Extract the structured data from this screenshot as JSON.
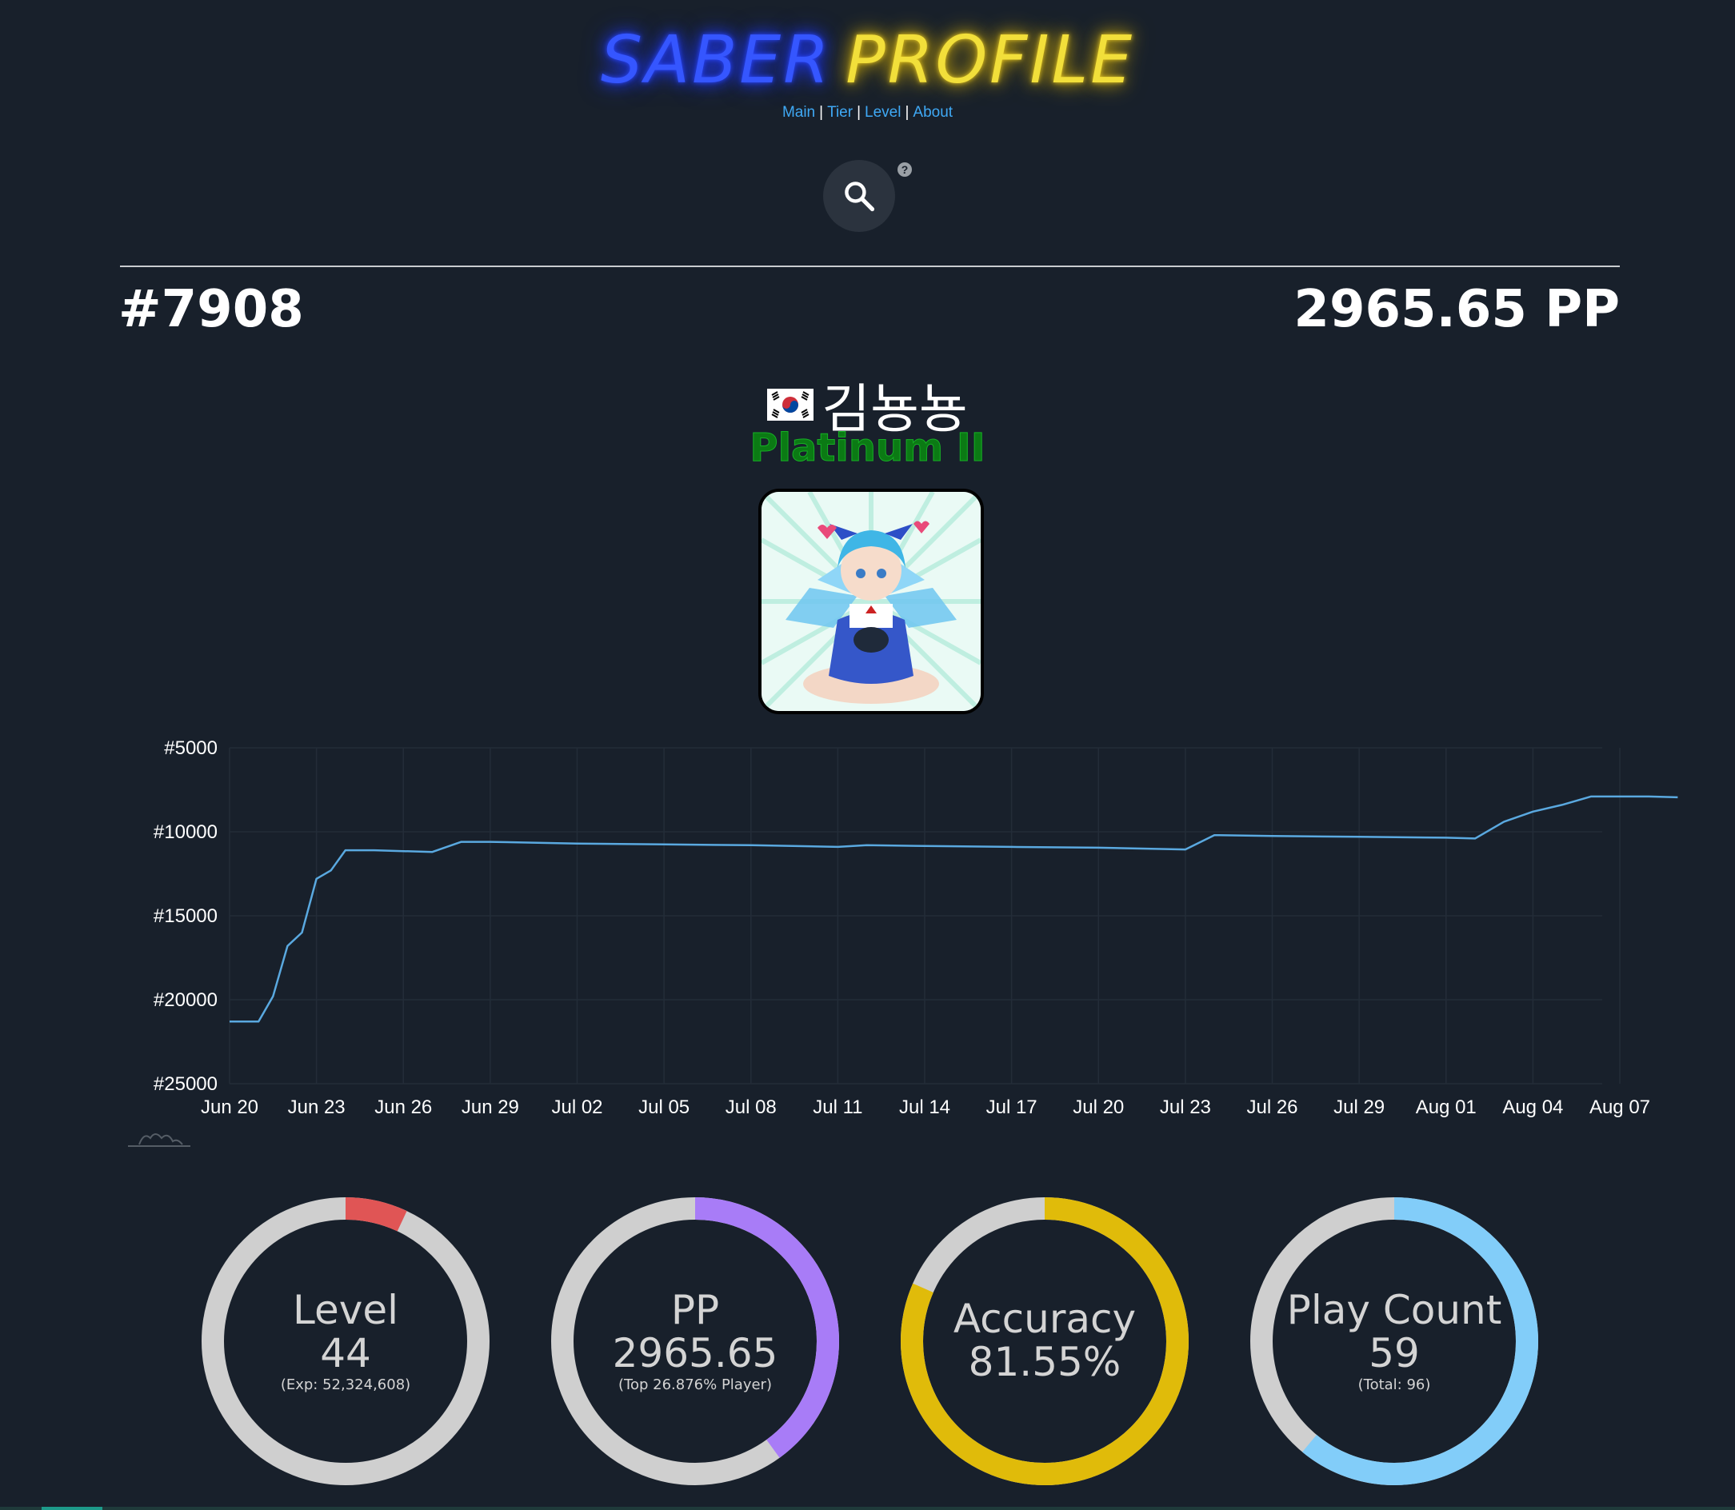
{
  "site": {
    "title_part1": "SABER",
    "title_part2": "PROFILE",
    "nav": [
      "Main",
      "Tier",
      "Level",
      "About"
    ],
    "search_icon": "search-icon",
    "help_icon": "question-circle-icon",
    "help_glyph": "?"
  },
  "profile": {
    "rank": "#7908",
    "pp": "2965.65 PP",
    "country_flag": "south-korea-flag-icon",
    "name": "김뇽뇽",
    "tier": "Platinum II",
    "tier_color": "#0b7a14",
    "avatar": "anime-character-avatar"
  },
  "chart_data": {
    "type": "line",
    "y_reversed": true,
    "ylim": [
      5000,
      25000
    ],
    "y_ticks": [
      "#5000",
      "#10000",
      "#15000",
      "#20000",
      "#25000"
    ],
    "x_ticks": [
      "Jun 20",
      "Jun 23",
      "Jun 26",
      "Jun 29",
      "Jul 02",
      "Jul 05",
      "Jul 08",
      "Jul 11",
      "Jul 14",
      "Jul 17",
      "Jul 20",
      "Jul 23",
      "Jul 26",
      "Jul 29",
      "Aug 01",
      "Aug 04",
      "Aug 07"
    ],
    "series_color": "#5aa9e0",
    "grid": true,
    "series": [
      {
        "x": [
          "Jun 20",
          "Jun 21",
          "Jun 21",
          "Jun 22",
          "Jun 22",
          "Jun 23",
          "Jun 23",
          "Jun 24",
          "Jun 25",
          "Jun 26",
          "Jun 27",
          "Jun 28",
          "Jun 29",
          "Jul 02",
          "Jul 05",
          "Jul 08",
          "Jul 11",
          "Jul 12",
          "Jul 14",
          "Jul 17",
          "Jul 20",
          "Jul 23",
          "Jul 24",
          "Jul 26",
          "Jul 29",
          "Aug 01",
          "Aug 02",
          "Aug 03",
          "Aug 04",
          "Aug 05",
          "Aug 06",
          "Aug 07",
          "Aug 08",
          "Aug 09"
        ],
        "y": [
          21300,
          21300,
          19800,
          16800,
          16000,
          12800,
          12300,
          11100,
          11100,
          11150,
          11200,
          10600,
          10600,
          10700,
          10750,
          10800,
          10900,
          10800,
          10850,
          10900,
          10950,
          11050,
          10200,
          10250,
          10300,
          10350,
          10400,
          9400,
          8800,
          8400,
          7900,
          7900,
          7900,
          7950
        ]
      }
    ]
  },
  "stats": [
    {
      "label": "Level",
      "value": "44",
      "sub": "(Exp: 52,324,608)",
      "fraction": 0.07,
      "start": 0.0,
      "color": "#e05555"
    },
    {
      "label": "PP",
      "value": "2965.65",
      "sub": "(Top 26.876% Player)",
      "fraction": 0.4,
      "start": 0.0,
      "color": "#a87cf7"
    },
    {
      "label": "Accuracy",
      "value": "81.55%",
      "sub": "",
      "fraction": 0.8155,
      "start": 0.0,
      "color": "#e0bb0a"
    },
    {
      "label": "Play Count",
      "value": "59",
      "sub": "(Total: 96)",
      "fraction": 0.61,
      "start": 0.0,
      "color": "#82cdf9"
    }
  ],
  "gauge_track_color": "#cfcfcf"
}
